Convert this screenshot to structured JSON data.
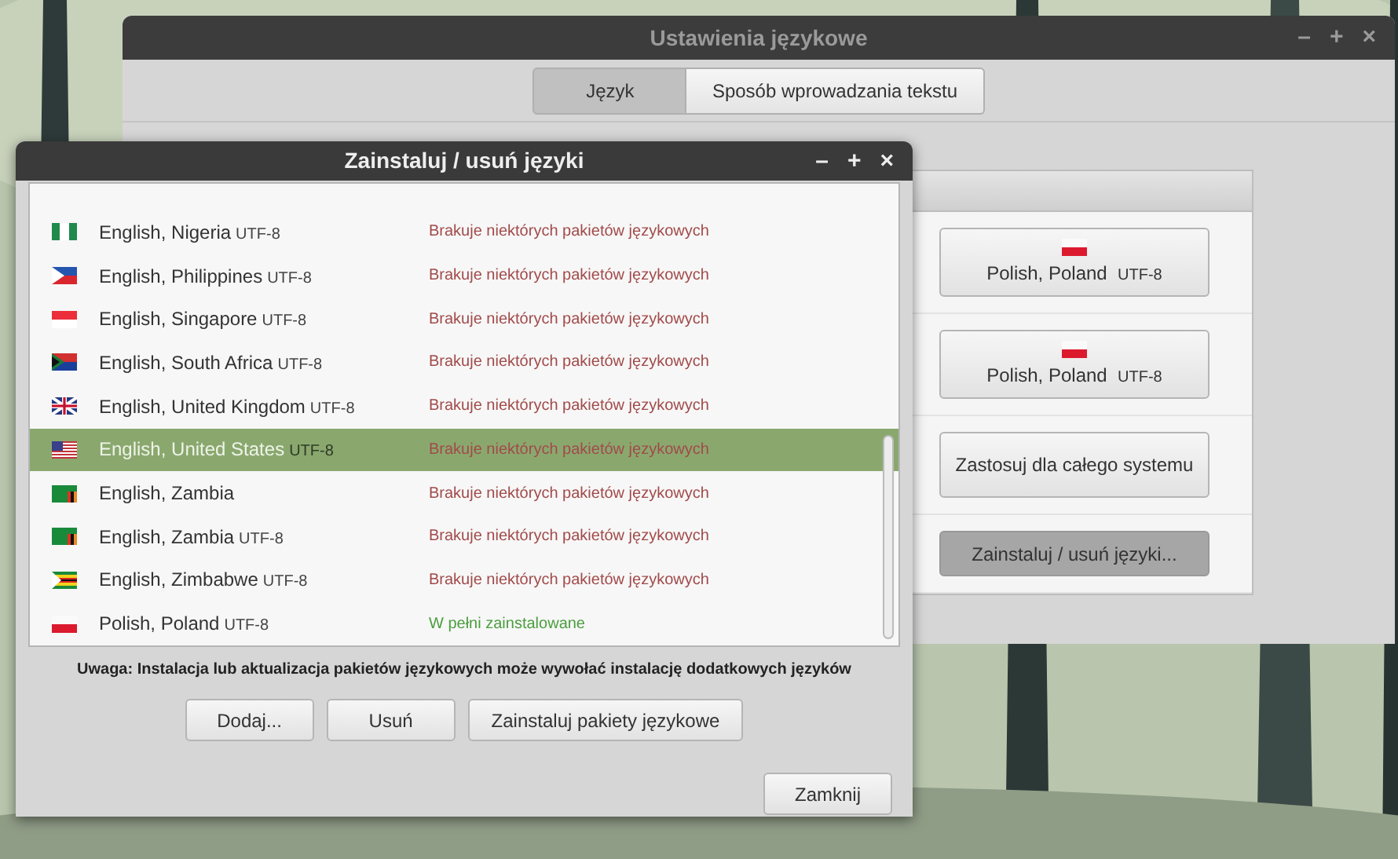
{
  "back_window": {
    "title": "Ustawienia językowe",
    "controls": [
      "–",
      "+",
      "×"
    ],
    "tabs": [
      {
        "label": "Język",
        "selected": true
      },
      {
        "label": "Sposób wprowadzania tekstu",
        "selected": false
      }
    ],
    "rows": [
      {
        "kind": "locale",
        "label": "Polish, Poland",
        "encoding": "UTF-8"
      },
      {
        "kind": "locale",
        "label": "Polish, Poland",
        "encoding": "UTF-8"
      },
      {
        "kind": "action",
        "label": "Zastosuj dla całego systemu",
        "pressed": false
      },
      {
        "kind": "action",
        "label": "Zainstaluj / usuń języki...",
        "pressed": true
      }
    ]
  },
  "dialog": {
    "title": "Zainstaluj / usuń języki",
    "controls": [
      "–",
      "+",
      "×"
    ],
    "languages": [
      {
        "name": "English, Nigeria",
        "encoding": "UTF-8",
        "kind": "ng",
        "status": "Brakuje niektórych pakietów językowych",
        "color": "#a24a4a",
        "selected": false
      },
      {
        "name": "English, Philippines",
        "encoding": "UTF-8",
        "kind": "ph",
        "status": "Brakuje niektórych pakietów językowych",
        "color": "#a24a4a",
        "selected": false
      },
      {
        "name": "English, Singapore",
        "encoding": "UTF-8",
        "kind": "sg",
        "status": "Brakuje niektórych pakietów językowych",
        "color": "#a24a4a",
        "selected": false
      },
      {
        "name": "English, South Africa",
        "encoding": "UTF-8",
        "kind": "za",
        "status": "Brakuje niektórych pakietów językowych",
        "color": "#a24a4a",
        "selected": false
      },
      {
        "name": "English, United Kingdom",
        "encoding": "UTF-8",
        "kind": "gb",
        "status": "Brakuje niektórych pakietów językowych",
        "color": "#a24a4a",
        "selected": false
      },
      {
        "name": "English, United States",
        "encoding": "UTF-8",
        "kind": "us",
        "status": "Brakuje niektórych pakietów językowych",
        "color": "#a24a4a",
        "selected": true
      },
      {
        "name": "English, Zambia",
        "kind": "zm",
        "status": "Brakuje niektórych pakietów językowych",
        "color": "#a24a4a",
        "selected": false
      },
      {
        "name": "English, Zambia",
        "encoding": "UTF-8",
        "kind": "zm",
        "status": "Brakuje niektórych pakietów językowych",
        "color": "#a24a4a",
        "selected": false
      },
      {
        "name": "English, Zimbabwe",
        "encoding": "UTF-8",
        "kind": "zw",
        "status": "Brakuje niektórych pakietów językowych",
        "color": "#a24a4a",
        "selected": false
      },
      {
        "name": "Polish, Poland",
        "encoding": "UTF-8",
        "kind": "pl",
        "status": "W pełni zainstalowane",
        "color": "#4a9e3e",
        "selected": false
      }
    ],
    "note": "Uwaga: Instalacja lub aktualizacja pakietów językowych może wywołać instalację dodatkowych języków",
    "buttons": [
      "Dodaj...",
      "Usuń",
      "Zainstaluj pakiety językowe"
    ],
    "close_button": "Zamknij"
  }
}
